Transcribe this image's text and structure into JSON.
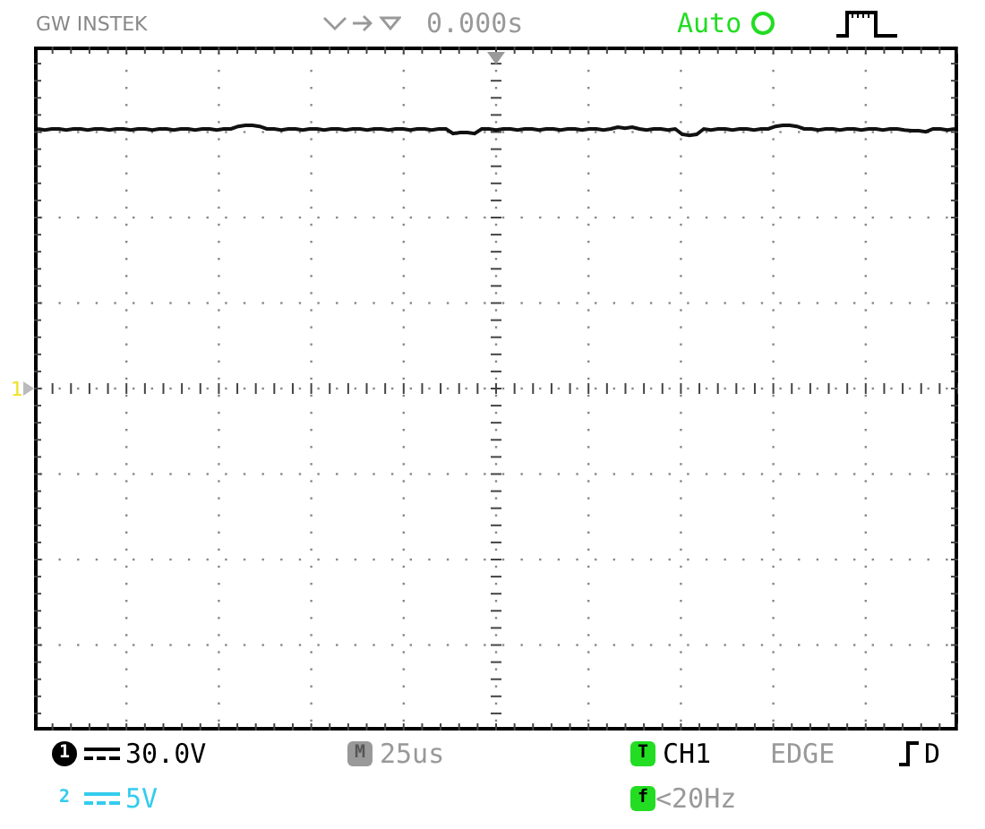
{
  "header": {
    "brand": "GW INSTEK",
    "time_offset": "0.000s",
    "trigger_mode": "Auto"
  },
  "screen": {
    "channel_marker": "1"
  },
  "status": {
    "ch1": {
      "badge": "1",
      "scale": "30.0V"
    },
    "ch2": {
      "badge": "2",
      "scale": "5V"
    },
    "timebase": {
      "badge": "M",
      "scale": "25us"
    },
    "trigger": {
      "badge": "T",
      "source": "CH1",
      "type": "EDGE",
      "coupling": "D"
    },
    "frequency": {
      "badge": "f",
      "value": "<20Hz"
    }
  }
}
